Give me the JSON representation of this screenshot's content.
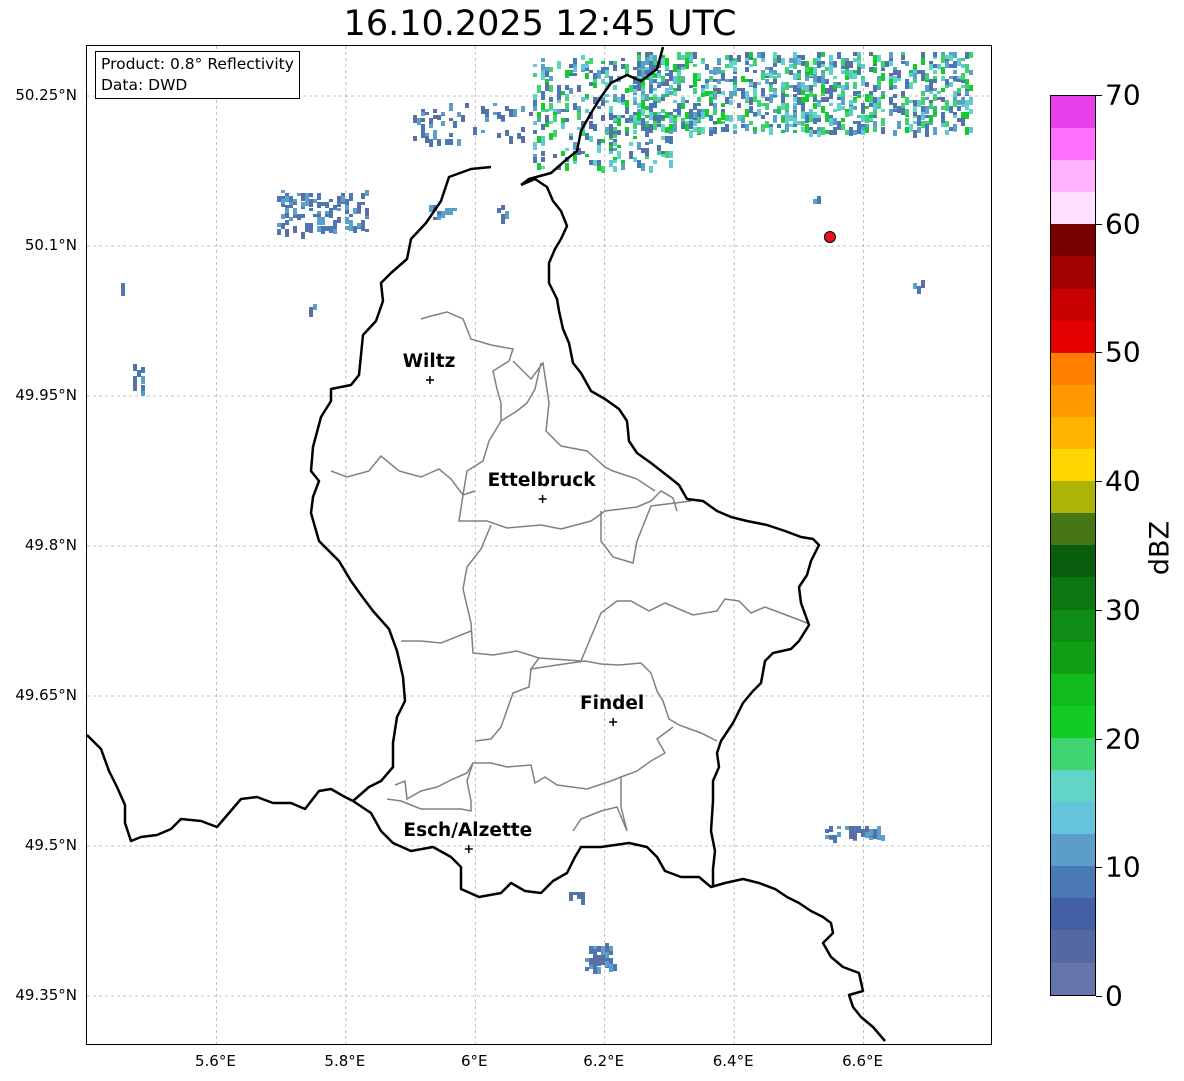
{
  "title": "16.10.2025 12:45 UTC",
  "info_box": {
    "product_line": "Product: 0.8° Reflectivity",
    "data_line": "Data: DWD"
  },
  "map": {
    "lon_range": [
      5.4,
      6.8
    ],
    "lat_range": [
      49.3,
      50.3
    ],
    "lat_ticks": [
      {
        "value": 50.25,
        "label": "50.25°N"
      },
      {
        "value": 50.1,
        "label": "50.1°N"
      },
      {
        "value": 49.95,
        "label": "49.95°N"
      },
      {
        "value": 49.8,
        "label": "49.8°N"
      },
      {
        "value": 49.65,
        "label": "49.65°N"
      },
      {
        "value": 49.5,
        "label": "49.5°N"
      },
      {
        "value": 49.35,
        "label": "49.35°N"
      }
    ],
    "lon_ticks": [
      {
        "value": 5.6,
        "label": "5.6°E"
      },
      {
        "value": 5.8,
        "label": "5.8°E"
      },
      {
        "value": 6.0,
        "label": "6°E"
      },
      {
        "value": 6.2,
        "label": "6.2°E"
      },
      {
        "value": 6.4,
        "label": "6.4°E"
      },
      {
        "value": 6.6,
        "label": "6.6°E"
      }
    ],
    "cities": [
      {
        "name": "Wiltz",
        "lon": 5.93,
        "lat": 49.966
      },
      {
        "name": "Ettelbruck",
        "lon": 6.104,
        "lat": 49.847
      },
      {
        "name": "Findel",
        "lon": 6.213,
        "lat": 49.624
      },
      {
        "name": "Esch/Alzette",
        "lon": 5.99,
        "lat": 49.497
      }
    ],
    "radar_site": {
      "lon": 6.548,
      "lat": 50.109,
      "color": "#e8131b"
    },
    "echo_colors": [
      "#5a6fa6",
      "#4b78b4",
      "#5aa0c8",
      "#63c6d9",
      "#5fd6c4",
      "#3fd36f",
      "#14cc2a"
    ],
    "grid_lines": true
  },
  "colorbar": {
    "label": "dBZ",
    "min": 0,
    "max": 70,
    "step": 2.5,
    "ticks": [
      0,
      10,
      20,
      30,
      40,
      50,
      60,
      70
    ],
    "colors": [
      "#6576aa",
      "#5468a2",
      "#4460a5",
      "#4a79b4",
      "#5a9ec9",
      "#66c3dc",
      "#62d6c6",
      "#3fd472",
      "#12cc23",
      "#12bb1c",
      "#109f14",
      "#0f8c15",
      "#0c7612",
      "#085e0c",
      "#477617",
      "#abb407",
      "#ffd700",
      "#ffb400",
      "#ff9900",
      "#ff7f00",
      "#e50000",
      "#c80000",
      "#a30000",
      "#7a0000",
      "#ffdfff",
      "#ffb2ff",
      "#ff70ff",
      "#e93fea"
    ]
  }
}
